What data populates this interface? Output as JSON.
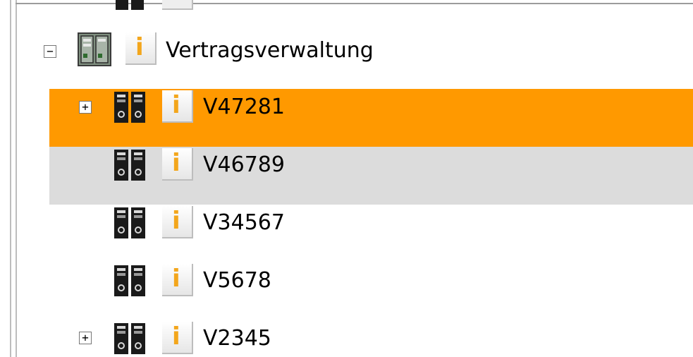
{
  "tree": {
    "parent": {
      "label": "Vertragsverwaltung",
      "toggle": "−"
    },
    "items": [
      {
        "label": "V47281",
        "toggle": "+",
        "state": "selected"
      },
      {
        "label": "V46789",
        "toggle": "",
        "state": "hover"
      },
      {
        "label": "V34567",
        "toggle": "",
        "state": "normal"
      },
      {
        "label": "V5678",
        "toggle": "",
        "state": "normal"
      },
      {
        "label": "V2345",
        "toggle": "+",
        "state": "normal"
      }
    ],
    "info_glyph": "i"
  },
  "colors": {
    "selected": "#ff9900",
    "hover": "#dcdcdc",
    "info": "#f3a61c"
  }
}
